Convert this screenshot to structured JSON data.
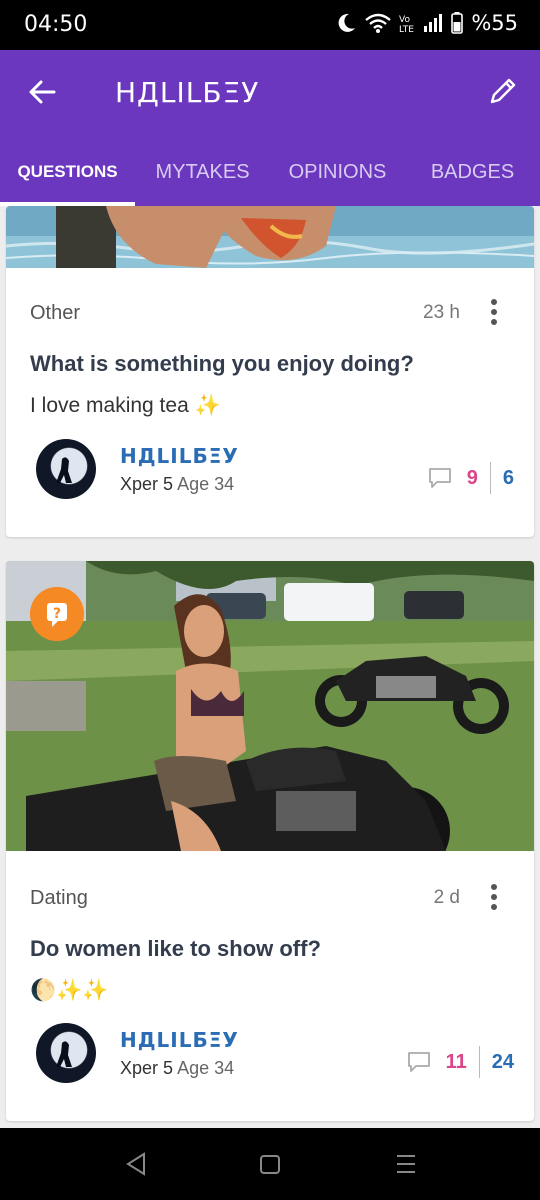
{
  "status_bar": {
    "time": "04:50",
    "battery": "%55"
  },
  "app_bar": {
    "title": "НДLILБΞУ"
  },
  "tabs": [
    {
      "label": "QUESTIONS",
      "active": true
    },
    {
      "label": "MYTAKES",
      "active": false
    },
    {
      "label": "OPINIONS",
      "active": false
    },
    {
      "label": "BADGES",
      "active": false
    }
  ],
  "cards": [
    {
      "category": "Other",
      "age": "23 h",
      "title": "What is something you enjoy doing?",
      "body": "I love making tea ✨",
      "author": {
        "name": "НДLILБΞУ",
        "level": "Xper 5",
        "age_label": "Age 34"
      },
      "comments": "9",
      "opinions": "6"
    },
    {
      "category": "Dating",
      "age": "2 d",
      "title": "Do women like to show off?",
      "body": "🌔✨✨",
      "author": {
        "name": "НДLILБΞУ",
        "level": "Xper 5",
        "age_label": "Age 34"
      },
      "comments": "11",
      "opinions": "24"
    }
  ],
  "colors": {
    "app_bar": "#6b37bf",
    "author_name": "#2a6db5",
    "comment_count": "#d9468a",
    "question_badge": "#f58a25"
  }
}
